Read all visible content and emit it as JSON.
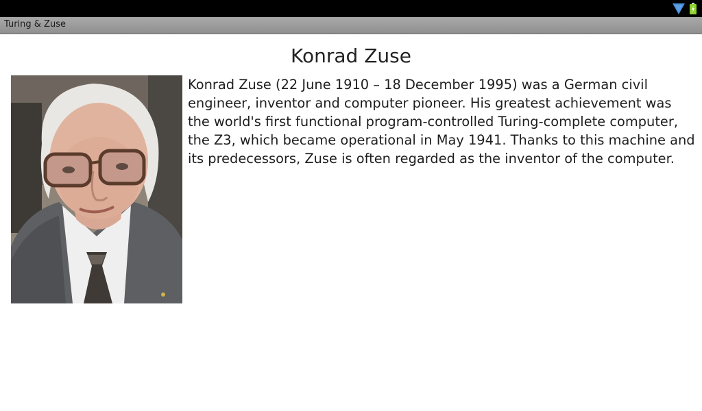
{
  "status_bar": {
    "icons": [
      "wifi-icon",
      "battery-icon"
    ],
    "wifi_color": "#4a8fd8",
    "battery_color": "#8ed12f"
  },
  "title_bar": {
    "title": "Turing & Zuse"
  },
  "content": {
    "heading": "Konrad Zuse",
    "portrait_alt": "Konrad Zuse",
    "bio": "Konrad Zuse (22 June 1910 – 18 December 1995) was a German civil engineer, inventor and computer pioneer. His greatest achievement was the world's first functional program-controlled Turing-complete computer, the Z3, which became operational in May 1941. Thanks to this machine and its predecessors, Zuse is often regarded as the inventor of the computer."
  }
}
